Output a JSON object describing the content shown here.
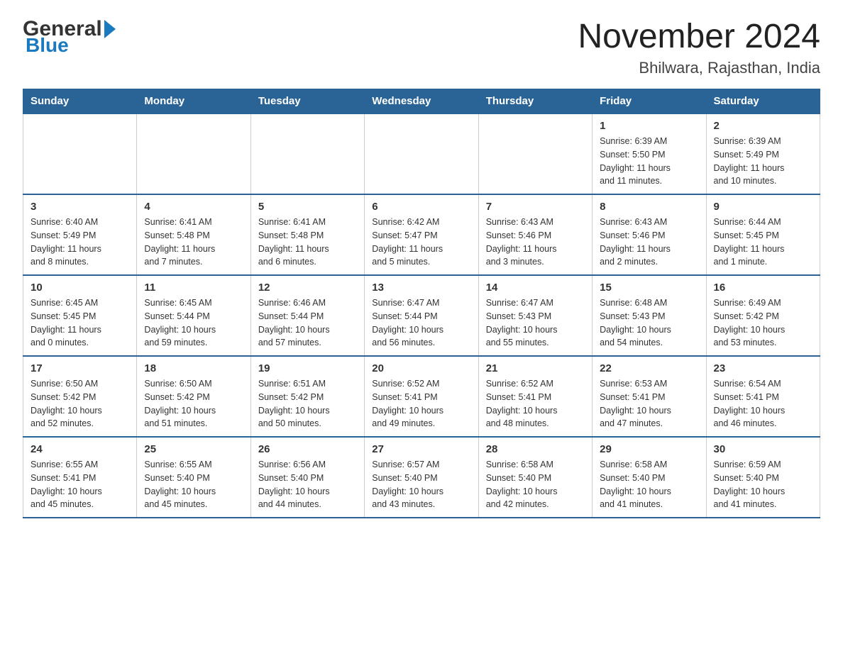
{
  "logo": {
    "general": "General",
    "blue": "Blue"
  },
  "title": {
    "month_year": "November 2024",
    "location": "Bhilwara, Rajasthan, India"
  },
  "weekdays": [
    "Sunday",
    "Monday",
    "Tuesday",
    "Wednesday",
    "Thursday",
    "Friday",
    "Saturday"
  ],
  "weeks": [
    [
      {
        "day": "",
        "info": ""
      },
      {
        "day": "",
        "info": ""
      },
      {
        "day": "",
        "info": ""
      },
      {
        "day": "",
        "info": ""
      },
      {
        "day": "",
        "info": ""
      },
      {
        "day": "1",
        "info": "Sunrise: 6:39 AM\nSunset: 5:50 PM\nDaylight: 11 hours\nand 11 minutes."
      },
      {
        "day": "2",
        "info": "Sunrise: 6:39 AM\nSunset: 5:49 PM\nDaylight: 11 hours\nand 10 minutes."
      }
    ],
    [
      {
        "day": "3",
        "info": "Sunrise: 6:40 AM\nSunset: 5:49 PM\nDaylight: 11 hours\nand 8 minutes."
      },
      {
        "day": "4",
        "info": "Sunrise: 6:41 AM\nSunset: 5:48 PM\nDaylight: 11 hours\nand 7 minutes."
      },
      {
        "day": "5",
        "info": "Sunrise: 6:41 AM\nSunset: 5:48 PM\nDaylight: 11 hours\nand 6 minutes."
      },
      {
        "day": "6",
        "info": "Sunrise: 6:42 AM\nSunset: 5:47 PM\nDaylight: 11 hours\nand 5 minutes."
      },
      {
        "day": "7",
        "info": "Sunrise: 6:43 AM\nSunset: 5:46 PM\nDaylight: 11 hours\nand 3 minutes."
      },
      {
        "day": "8",
        "info": "Sunrise: 6:43 AM\nSunset: 5:46 PM\nDaylight: 11 hours\nand 2 minutes."
      },
      {
        "day": "9",
        "info": "Sunrise: 6:44 AM\nSunset: 5:45 PM\nDaylight: 11 hours\nand 1 minute."
      }
    ],
    [
      {
        "day": "10",
        "info": "Sunrise: 6:45 AM\nSunset: 5:45 PM\nDaylight: 11 hours\nand 0 minutes."
      },
      {
        "day": "11",
        "info": "Sunrise: 6:45 AM\nSunset: 5:44 PM\nDaylight: 10 hours\nand 59 minutes."
      },
      {
        "day": "12",
        "info": "Sunrise: 6:46 AM\nSunset: 5:44 PM\nDaylight: 10 hours\nand 57 minutes."
      },
      {
        "day": "13",
        "info": "Sunrise: 6:47 AM\nSunset: 5:44 PM\nDaylight: 10 hours\nand 56 minutes."
      },
      {
        "day": "14",
        "info": "Sunrise: 6:47 AM\nSunset: 5:43 PM\nDaylight: 10 hours\nand 55 minutes."
      },
      {
        "day": "15",
        "info": "Sunrise: 6:48 AM\nSunset: 5:43 PM\nDaylight: 10 hours\nand 54 minutes."
      },
      {
        "day": "16",
        "info": "Sunrise: 6:49 AM\nSunset: 5:42 PM\nDaylight: 10 hours\nand 53 minutes."
      }
    ],
    [
      {
        "day": "17",
        "info": "Sunrise: 6:50 AM\nSunset: 5:42 PM\nDaylight: 10 hours\nand 52 minutes."
      },
      {
        "day": "18",
        "info": "Sunrise: 6:50 AM\nSunset: 5:42 PM\nDaylight: 10 hours\nand 51 minutes."
      },
      {
        "day": "19",
        "info": "Sunrise: 6:51 AM\nSunset: 5:42 PM\nDaylight: 10 hours\nand 50 minutes."
      },
      {
        "day": "20",
        "info": "Sunrise: 6:52 AM\nSunset: 5:41 PM\nDaylight: 10 hours\nand 49 minutes."
      },
      {
        "day": "21",
        "info": "Sunrise: 6:52 AM\nSunset: 5:41 PM\nDaylight: 10 hours\nand 48 minutes."
      },
      {
        "day": "22",
        "info": "Sunrise: 6:53 AM\nSunset: 5:41 PM\nDaylight: 10 hours\nand 47 minutes."
      },
      {
        "day": "23",
        "info": "Sunrise: 6:54 AM\nSunset: 5:41 PM\nDaylight: 10 hours\nand 46 minutes."
      }
    ],
    [
      {
        "day": "24",
        "info": "Sunrise: 6:55 AM\nSunset: 5:41 PM\nDaylight: 10 hours\nand 45 minutes."
      },
      {
        "day": "25",
        "info": "Sunrise: 6:55 AM\nSunset: 5:40 PM\nDaylight: 10 hours\nand 45 minutes."
      },
      {
        "day": "26",
        "info": "Sunrise: 6:56 AM\nSunset: 5:40 PM\nDaylight: 10 hours\nand 44 minutes."
      },
      {
        "day": "27",
        "info": "Sunrise: 6:57 AM\nSunset: 5:40 PM\nDaylight: 10 hours\nand 43 minutes."
      },
      {
        "day": "28",
        "info": "Sunrise: 6:58 AM\nSunset: 5:40 PM\nDaylight: 10 hours\nand 42 minutes."
      },
      {
        "day": "29",
        "info": "Sunrise: 6:58 AM\nSunset: 5:40 PM\nDaylight: 10 hours\nand 41 minutes."
      },
      {
        "day": "30",
        "info": "Sunrise: 6:59 AM\nSunset: 5:40 PM\nDaylight: 10 hours\nand 41 minutes."
      }
    ]
  ]
}
